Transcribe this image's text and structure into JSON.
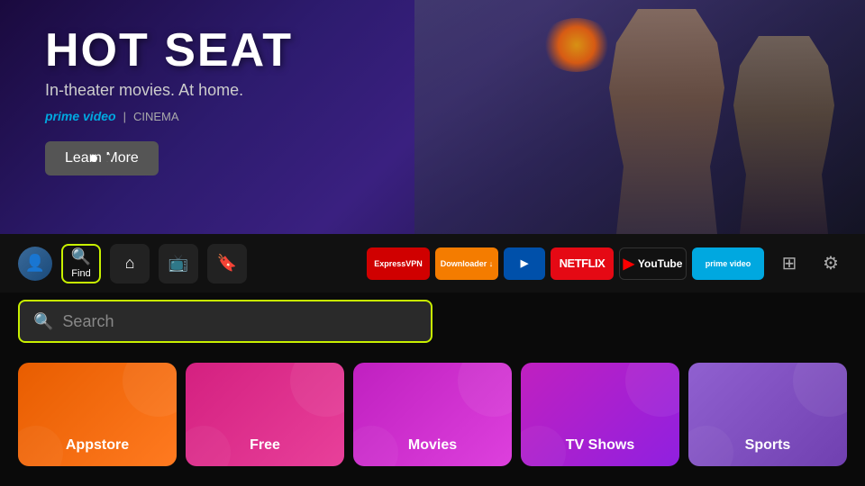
{
  "hero": {
    "title": "HOT SEAT",
    "subtitle": "In-theater movies. At home.",
    "brand_prime": "prime video",
    "brand_separator": "|",
    "brand_cinema": "CINEMA",
    "learn_more_label": "Learn More",
    "dots": [
      "active",
      "inactive"
    ]
  },
  "navbar": {
    "avatar_icon": "👤",
    "find_icon": "🔍",
    "find_label": "Find",
    "home_icon": "⌂",
    "tv_icon": "📺",
    "bookmark_icon": "🔖",
    "apps": [
      {
        "id": "expressvpn",
        "label": "ExpressVPN"
      },
      {
        "id": "downloader",
        "label": "Downloader ↓"
      },
      {
        "id": "blue-app",
        "label": ">"
      },
      {
        "id": "netflix",
        "label": "NETFLIX"
      },
      {
        "id": "youtube",
        "label": "YouTube"
      },
      {
        "id": "prime",
        "label": "prime video"
      }
    ],
    "grid_icon": "⊞",
    "gear_icon": "⚙"
  },
  "search": {
    "placeholder": "Search"
  },
  "categories": [
    {
      "id": "appstore",
      "label": "Appstore",
      "color_class": "appstore"
    },
    {
      "id": "free",
      "label": "Free",
      "color_class": "free"
    },
    {
      "id": "movies",
      "label": "Movies",
      "color_class": "movies"
    },
    {
      "id": "tvshows",
      "label": "TV Shows",
      "color_class": "tvshows"
    },
    {
      "id": "sports",
      "label": "Sports",
      "color_class": "sports"
    }
  ]
}
